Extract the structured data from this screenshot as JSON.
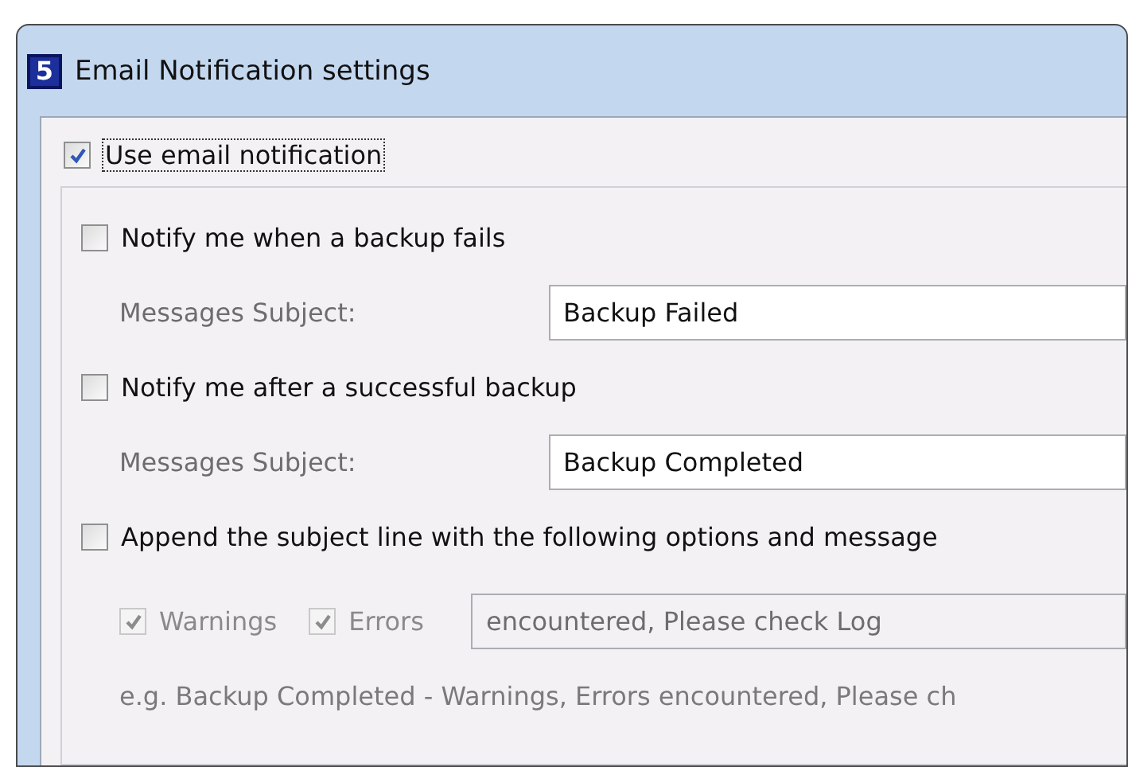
{
  "window": {
    "title": "Email Notification settings",
    "app_icon_text": "5"
  },
  "use_email": {
    "label": "Use email notification",
    "checked": true
  },
  "rows": [
    {
      "kind": "checkbox",
      "label": "Notify me when a backup fails",
      "checked": false
    },
    {
      "kind": "subject",
      "label": "Messages Subject:",
      "value": "Backup Failed"
    },
    {
      "kind": "checkbox",
      "label": "Notify me after a successful backup",
      "checked": false
    },
    {
      "kind": "subject",
      "label": "Messages Subject:",
      "value": "Backup Completed"
    },
    {
      "kind": "checkbox",
      "label": "Append the subject line with the following options and message",
      "checked": false
    }
  ],
  "options": {
    "items": [
      {
        "label": "Warnings",
        "checked": true,
        "disabled": true
      },
      {
        "label": "Errors",
        "checked": true,
        "disabled": true
      }
    ],
    "message": "encountered, Please check Log",
    "disabled": true
  },
  "example": "e.g. Backup Completed - Warnings, Errors encountered, Please ch"
}
